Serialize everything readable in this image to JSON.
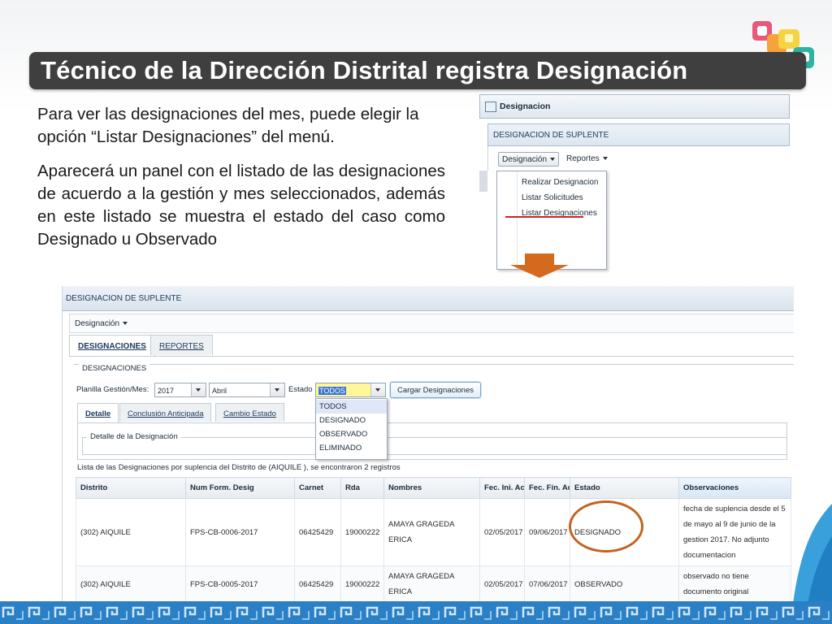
{
  "slide": {
    "title": "Técnico de la Dirección Distrital registra Designación",
    "paragraph1": "Para ver las designaciones del mes, puede elegir la opción “Listar Designaciones” del menú.",
    "paragraph2": "Aparecerá un panel con el listado de las designaciones de acuerdo a la gestión y mes seleccionados, además en este listado se muestra el estado del caso como Designado u Observado",
    "colors": {
      "title_bg": "#3f3f40",
      "arrow": "#d46a1e",
      "circle": "#c4621f",
      "underline": "#d21f1f",
      "band": "#2b7fc4"
    }
  },
  "menu_screenshot": {
    "window_title": "Designacion",
    "panel_title": "DESIGNACION DE SUPLENTE",
    "menu": {
      "designacion": "Designación",
      "reportes": "Reportes"
    },
    "dropdown_items": [
      "Realizar Designacion",
      "Listar Solicitudes",
      "Listar Designaciones"
    ]
  },
  "main_screenshot": {
    "panel_title": "DESIGNACION DE SUPLENTE",
    "menu_designacion": "Designación",
    "tabs": [
      "DESIGNACIONES",
      "REPORTES"
    ],
    "fieldset_legend": "DESIGNACIONES",
    "planilla_label": "Planilla Gestión/Mes:",
    "year_value": "2017",
    "month_value": "Abril",
    "estado_label": "Estado",
    "estado_value": "TODOS",
    "load_button": "Cargar Designaciones",
    "estado_options": [
      "TODOS",
      "DESIGNADO",
      "OBSERVADO",
      "ELIMINADO"
    ],
    "subtabs": [
      "Detalle",
      "Conclusión Anticipada",
      "Cambio Estado"
    ],
    "detalle_legend": "Detalle de la Designación",
    "summary": "Lista de las Designaciones por suplencia del Distrito de (AIQUILE ), se encontraron 2 registros",
    "columns": [
      "Distrito",
      "Num Form. Desig",
      "Carnet",
      "Rda",
      "Nombres",
      "Fec. Ini. Act",
      "Fec. Fin. Act",
      "Estado",
      "Observaciones"
    ],
    "rows": [
      {
        "distrito": "(302) AIQUILE",
        "num_form": "FPS-CB-0006-2017",
        "carnet": "06425429",
        "rda": "19000222",
        "nombres": "AMAYA GRAGEDA ERICA",
        "fec_ini": "02/05/2017",
        "fec_fin": "09/06/2017",
        "estado": "DESIGNADO",
        "observaciones": "fecha de suplencia desde el 5 de mayo al 9 de junio de la gestion 2017. No adjunto documentacion"
      },
      {
        "distrito": "(302) AIQUILE",
        "num_form": "FPS-CB-0005-2017",
        "carnet": "06425429",
        "rda": "19000222",
        "nombres": "AMAYA GRAGEDA ERICA",
        "fec_ini": "02/05/2017",
        "fec_fin": "07/06/2017",
        "estado": "OBSERVADO",
        "observaciones": "observado no tiene documento original"
      }
    ]
  }
}
